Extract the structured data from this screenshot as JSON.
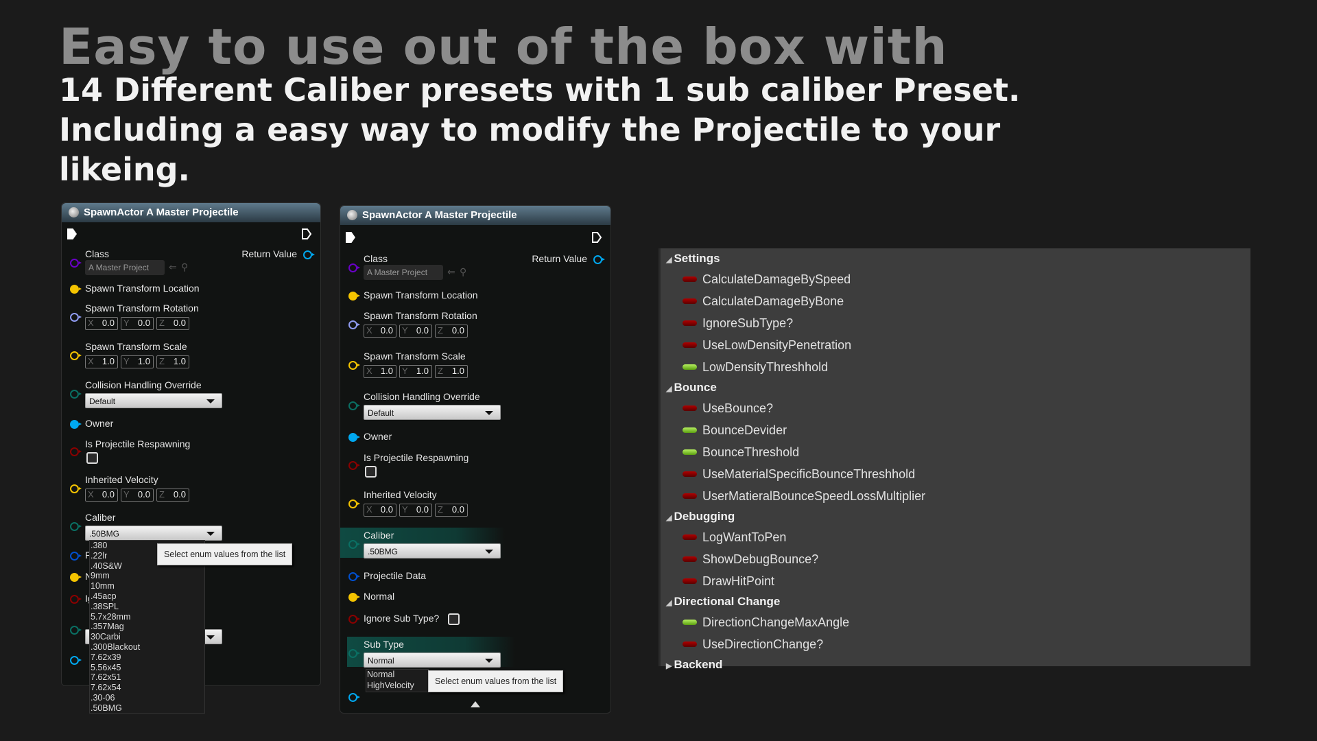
{
  "headline": {
    "line1": "Easy to use out of the box with",
    "line2": "14 Different Caliber presets with 1 sub caliber Preset.",
    "line3": "Including a easy way to modify the Projectile to your",
    "line4": "likeing."
  },
  "node_title": "SpawnActor A Master Projectile",
  "pins": {
    "class": "Class",
    "class_value": "A Master Project",
    "return_value": "Return Value",
    "spawn_location": "Spawn Transform Location",
    "spawn_rotation": "Spawn Transform Rotation",
    "spawn_scale": "Spawn Transform Scale",
    "collision": "Collision Handling Override",
    "collision_value": "Default",
    "owner": "Owner",
    "respawning": "Is Projectile Respawning",
    "inherited_velocity": "Inherited Velocity",
    "caliber": "Caliber",
    "caliber_value": ".50BMG",
    "projectile_data": "Projectile Data",
    "normal": "Normal",
    "ignore_sub_type": "Ignore Sub Type?",
    "sub_type": "Sub Type",
    "sub_type_value": "Normal"
  },
  "vectors": {
    "axes": [
      "X",
      "Y",
      "Z"
    ],
    "rotation": [
      "0.0",
      "0.0",
      "0.0"
    ],
    "scale": [
      "1.0",
      "1.0",
      "1.0"
    ],
    "velocity": [
      "0.0",
      "0.0",
      "0.0"
    ]
  },
  "caliber_options": [
    ".380",
    ".22lr",
    ".40S&W",
    "9mm",
    "10mm",
    ".45acp",
    ".38SPL",
    "5.7x28mm",
    ".357Mag",
    "30Carbi",
    ".300Blackout",
    "7.62x39",
    "5.56x45",
    "7.62x51",
    "7.62x54",
    ".30-06",
    ".50BMG"
  ],
  "sub_type_options": [
    "Normal",
    "HighVelocity"
  ],
  "tooltip": "Select enum values from the list",
  "details": [
    {
      "category": "Settings",
      "expanded": true,
      "items": [
        {
          "name": "CalculateDamageBySpeed",
          "value": false
        },
        {
          "name": "CalculateDamageByBone",
          "value": false
        },
        {
          "name": "IgnoreSubType?",
          "value": false
        },
        {
          "name": "UseLowDensityPenetration",
          "value": false
        },
        {
          "name": "LowDensityThreshhold",
          "value": true
        }
      ]
    },
    {
      "category": "Bounce",
      "expanded": true,
      "items": [
        {
          "name": "UseBounce?",
          "value": false
        },
        {
          "name": "BounceDevider",
          "value": true
        },
        {
          "name": "BounceThreshold",
          "value": true
        },
        {
          "name": "UseMaterialSpecificBounceThreshhold",
          "value": false
        },
        {
          "name": "UserMatieralBounceSpeedLossMultiplier",
          "value": false
        }
      ]
    },
    {
      "category": "Debugging",
      "expanded": true,
      "items": [
        {
          "name": "LogWantToPen",
          "value": false
        },
        {
          "name": "ShowDebugBounce?",
          "value": false
        },
        {
          "name": "DrawHitPoint",
          "value": false
        }
      ]
    },
    {
      "category": "Directional Change",
      "expanded": true,
      "items": [
        {
          "name": "DirectionChangeMaxAngle",
          "value": true
        },
        {
          "name": "UseDirectionChange?",
          "value": false
        }
      ]
    },
    {
      "category": "Backend",
      "expanded": false,
      "items": []
    }
  ],
  "colors": {
    "struct_yellow": "#f5c400",
    "bool_red": "#8a0000",
    "object_blue": "#00a8f0",
    "class_purple": "#6a00c8",
    "enum_teal": "#0a6f63",
    "rotator_lavender": "#8f9bf0",
    "true_green": "#8fd640",
    "false_red": "#900000"
  }
}
